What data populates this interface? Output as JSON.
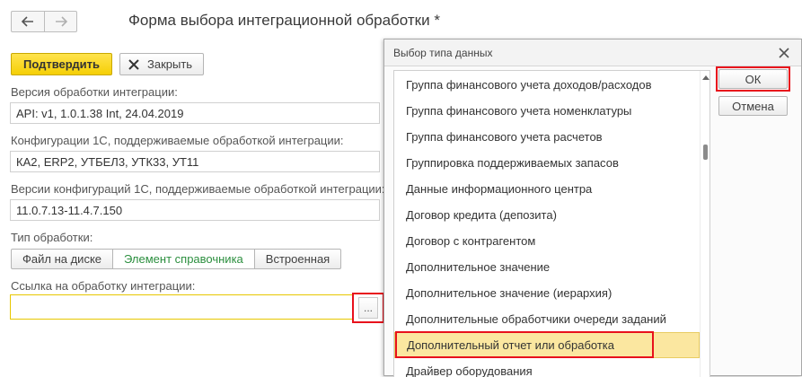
{
  "page": {
    "title": "Форма выбора интеграционной обработки *"
  },
  "toolbar": {
    "confirm_label": "Подтвердить",
    "close_label": "Закрыть"
  },
  "form": {
    "version_label": "Версия обработки интеграции:",
    "version_value": "API: v1, 1.0.1.38 Int, 24.04.2019",
    "configs_label": "Конфигурации 1С, поддерживаемые обработкой интеграции:",
    "configs_value": "КА2, ERP2, УТБЕЛ3, УТК33, УТ11",
    "config_versions_label": "Версии конфигураций 1С, поддерживаемые обработкой интеграции:",
    "config_versions_value": "11.0.7.13-11.4.7.150",
    "type_label": "Тип обработки:",
    "type_options": [
      "Файл на диске",
      "Элемент справочника",
      "Встроенная"
    ],
    "type_selected": "Элемент справочника",
    "link_label": "Ссылка на обработку интеграции:",
    "link_value": "",
    "link_button_label": "..."
  },
  "dialog": {
    "title": "Выбор типа данных",
    "ok_label": "ОК",
    "cancel_label": "Отмена",
    "items": [
      "Группа финансового учета доходов/расходов",
      "Группа финансового учета номенклатуры",
      "Группа финансового учета расчетов",
      "Группировка поддерживаемых запасов",
      "Данные информационного центра",
      "Договор кредита (депозита)",
      "Договор с контрагентом",
      "Дополнительное значение",
      "Дополнительное значение (иерархия)",
      "Дополнительные обработчики очереди заданий",
      "Дополнительный отчет или обработка",
      "Драйвер оборудования"
    ],
    "selected_index": 10
  },
  "colors": {
    "accent_yellow": "#f5cf05",
    "highlight_red": "#e8111c",
    "selection_bg": "#fbe7a0",
    "active_green": "#2c8f3f"
  }
}
